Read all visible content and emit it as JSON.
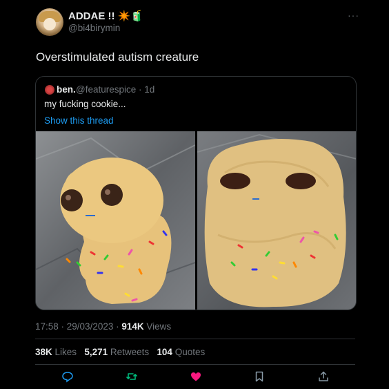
{
  "tweet": {
    "display_name": "ADDAE !! ✴️🧃",
    "handle": "@bi4birymin",
    "more": "···",
    "text": "Overstimulated autism creature"
  },
  "quote": {
    "name": "ben.",
    "handle": "@featurespice · 1d",
    "text": "my fucking cookie...",
    "link": "Show this thread"
  },
  "meta": {
    "time": "17:58 · 29/03/2023 · ",
    "views_count": "914K",
    "views_label": " Views"
  },
  "stats": {
    "likes_count": "38K",
    "likes_label": " Likes",
    "retweets_count": "5,271",
    "retweets_label": " Retweets",
    "quotes_count": "104",
    "quotes_label": " Quotes"
  },
  "colors": {
    "background": "#000000",
    "link": "#1d9bf0",
    "muted": "#71767b",
    "like_active": "#f91880",
    "border": "#2f3336"
  },
  "icons": [
    "reply-icon",
    "retweet-icon",
    "like-icon",
    "bookmark-icon",
    "share-icon"
  ]
}
